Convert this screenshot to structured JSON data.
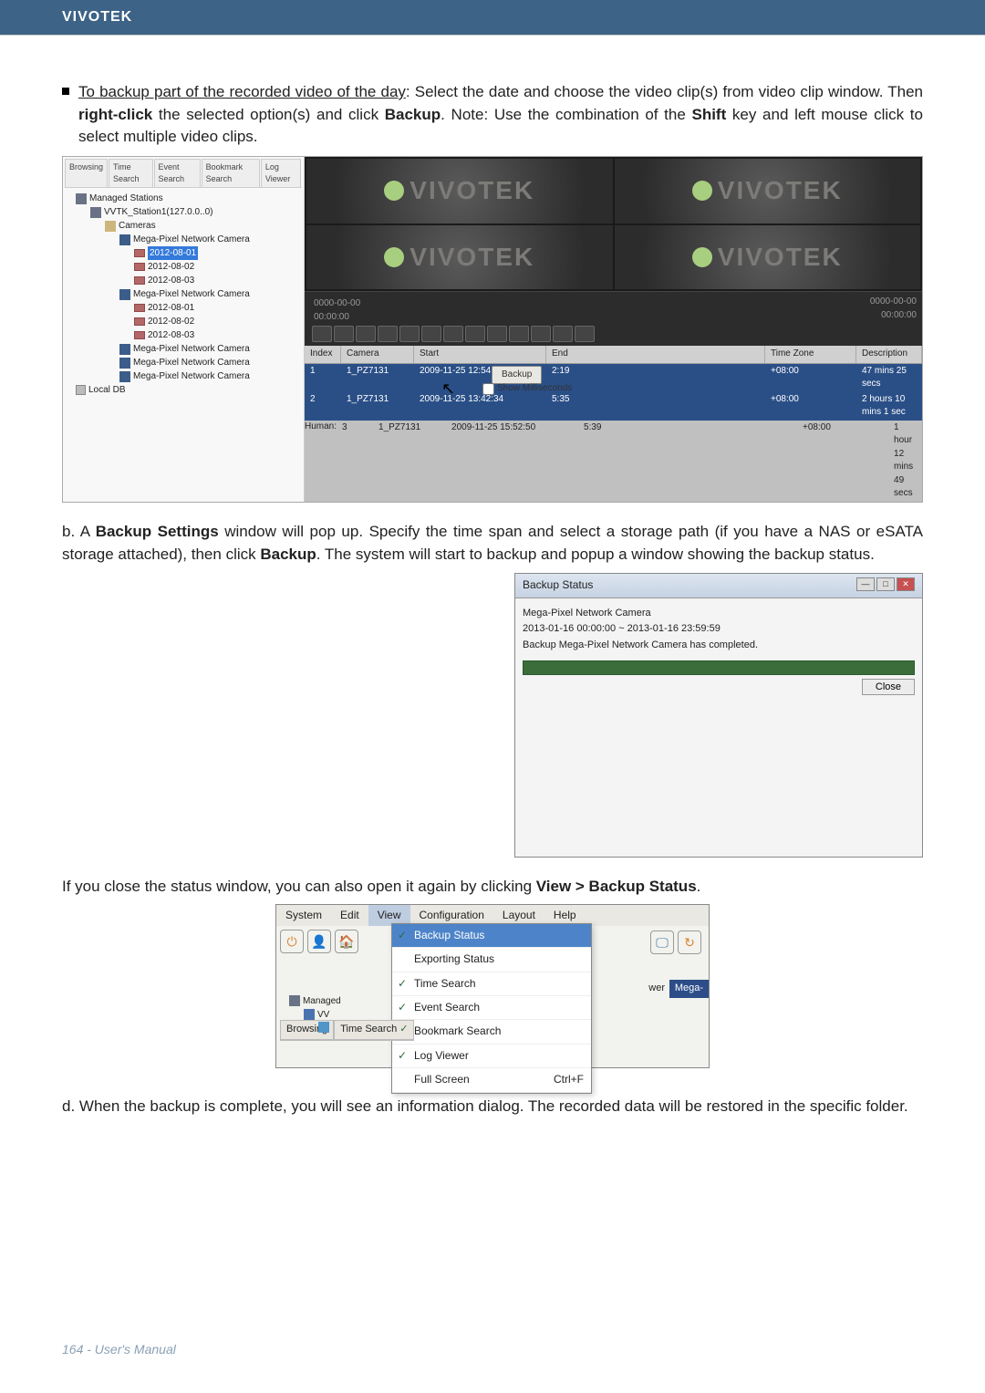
{
  "header": "VIVOTEK",
  "intro": {
    "lead": "To backup part of the recorded video of the day",
    "rest1": ": Select the date and choose the video clip(s) from video clip window. Then ",
    "bold1": "right-click",
    "rest2": " the selected option(s) and click ",
    "bold2": "Backup",
    "rest3": ". Note: Use the combination of the ",
    "bold3": "Shift",
    "rest4": " key and left mouse click to select multiple video clips."
  },
  "ss1": {
    "tabs": {
      "b": "Browsing",
      "t": "Time Search",
      "e": "Event Search",
      "k": "Bookmark Search",
      "l": "Log Viewer"
    },
    "tree": {
      "root": "Managed Stations",
      "station": "VVTK_Station1(127.0.0..0)",
      "cameras_label": "Cameras",
      "cam_label": "Mega-Pixel Network Camera",
      "dates": {
        "d1": "2012-08-01",
        "d2": "2012-08-02",
        "d3": "2012-08-03"
      },
      "cam2": "Mega-Pixel Network Camera",
      "local": "Local DB"
    },
    "brand": "VIVOTEK",
    "time": {
      "l1": "0000-00-00",
      "l2": "00:00:00",
      "r1": "0000-00-00",
      "r2": "00:00:00"
    },
    "table": {
      "h_idx": "Index",
      "h_cam": "Camera",
      "h_start": "Start",
      "h_end": "End",
      "h_tz": "Time Zone",
      "h_desc": "Description",
      "rows": [
        {
          "i": "1",
          "c": "1_PZ7131",
          "s": "2009-11-25 12:54:54",
          "e": "2:19",
          "tz": "+08:00",
          "d": "47 mins 25 secs"
        },
        {
          "i": "2",
          "c": "1_PZ7131",
          "s": "2009-11-25 13:42:34",
          "e": "5:35",
          "tz": "+08:00",
          "d": "2 hours 10 mins 1 sec"
        },
        {
          "i": "3",
          "c": "1_PZ7131",
          "s": "2009-11-25 15:52:50",
          "e": "5:39",
          "tz": "+08:00",
          "d": "1 hour 12 mins 49 secs"
        }
      ],
      "backup_btn": "Backup",
      "show_ms": "Show Milliseconds"
    }
  },
  "para_b": {
    "pre": "b. A ",
    "bold1": "Backup Settings",
    "mid1": " window will pop up. Specify the time span and select a storage path (if you have a NAS or eSATA storage attached), then click ",
    "bold2": "Backup",
    "post": ". The system will start to backup and popup a window showing the backup status."
  },
  "backup_status": {
    "title": "Backup Status",
    "l1": "Mega-Pixel Network Camera",
    "l2": "2013-01-16 00:00:00 ~ 2013-01-16 23:59:59",
    "l3": "Backup Mega-Pixel Network Camera has completed.",
    "close": "Close"
  },
  "para_c": {
    "text": "If you close the status window, you can also open it again by clicking ",
    "bold": "View > Backup Status",
    "dot": "."
  },
  "menu": {
    "items": {
      "sys": "System",
      "edit": "Edit",
      "view": "View",
      "conf": "Configuration",
      "layout": "Layout",
      "help": "Help"
    },
    "dd": {
      "backup": "Backup Status",
      "export": "Exporting Status",
      "time": "Time Search",
      "event": "Event Search",
      "bookmark": "Bookmark Search",
      "log": "Log Viewer",
      "full": "Full Screen",
      "shortcut": "Ctrl+F"
    },
    "tabs": {
      "b": "Browsing",
      "t": "Time Search"
    },
    "tree": {
      "managed": "Managed",
      "vv": "VV"
    },
    "wer": "wer",
    "mega": "Mega-"
  },
  "para_d": "d. When the backup is complete, you will see an information dialog. The recorded data will be restored in the specific folder.",
  "footer": "164 - User's Manual"
}
